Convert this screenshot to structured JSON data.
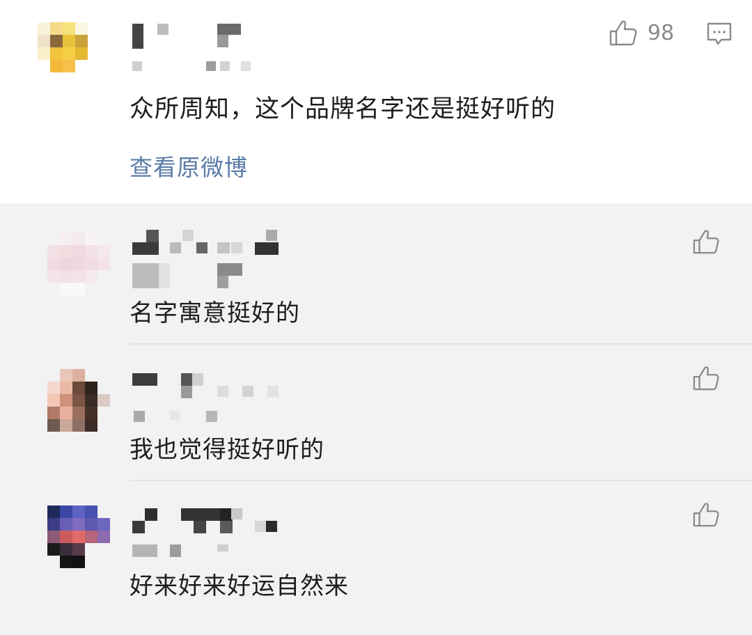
{
  "main_comment": {
    "text": "众所周知，这个品牌名字还是挺好听的",
    "like_count": "98",
    "view_original_label": "查看原微博"
  },
  "replies": [
    {
      "text": "名字寓意挺好的"
    },
    {
      "text": "我也觉得挺好听的"
    },
    {
      "text": "好来好来好运自然来"
    }
  ],
  "icons": {
    "like": "thumbs-up-icon",
    "comment": "comment-bubble-icon"
  },
  "colors": {
    "link": "#5b7ba8",
    "secondary_text": "#8a8a8a",
    "reply_background": "#f2f2f2",
    "main_background": "#ffffff"
  }
}
